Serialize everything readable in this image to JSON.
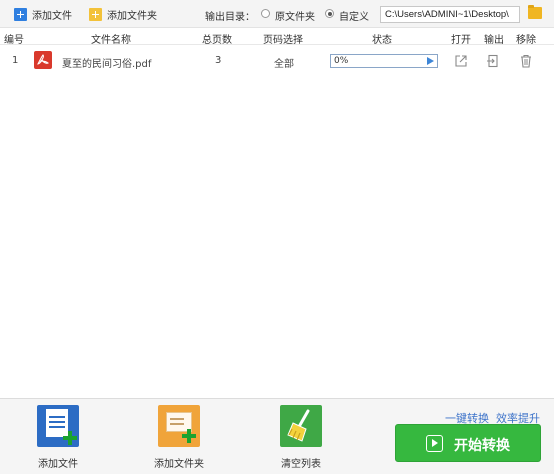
{
  "toolbar": {
    "add_file_label": "添加文件",
    "add_folder_label": "添加文件夹",
    "output_dir_label": "输出目录：",
    "radio_original_label": "原文件夹",
    "radio_custom_label": "自定义",
    "selected_output": "自定义",
    "output_path": "C:\\Users\\ADMINI~1\\Desktop\\"
  },
  "table": {
    "columns": {
      "index": "编号",
      "filename": "文件名称",
      "pages": "总页数",
      "page_select": "页码选择",
      "status": "状态",
      "open": "打开",
      "output": "输出",
      "remove": "移除"
    },
    "rows": [
      {
        "index": "1",
        "filename": "夏至的民间习俗.pdf",
        "pages": "3",
        "page_select": "全部",
        "progress_text": "0%",
        "progress_fraction": 0
      }
    ]
  },
  "bottom": {
    "add_file_label": "添加文件",
    "add_folder_label": "添加文件夹",
    "clear_list_label": "清空列表",
    "slogan_one": "一键转换",
    "slogan_two": "效率提升",
    "start_label": "开始转换"
  },
  "colors": {
    "accent_blue": "#2f7fe0",
    "folder_yellow": "#f3c23a",
    "pdf_red": "#d9392c",
    "start_green": "#36b83f",
    "slogan_blue": "#3d73c9"
  },
  "icons": [
    "add-file-icon",
    "add-folder-icon",
    "folder-browse-icon",
    "pdf-icon",
    "play-icon",
    "open-external-icon",
    "output-icon",
    "trash-icon",
    "document-plus-icon",
    "folder-plus-icon",
    "broom-icon",
    "play-square-icon"
  ]
}
